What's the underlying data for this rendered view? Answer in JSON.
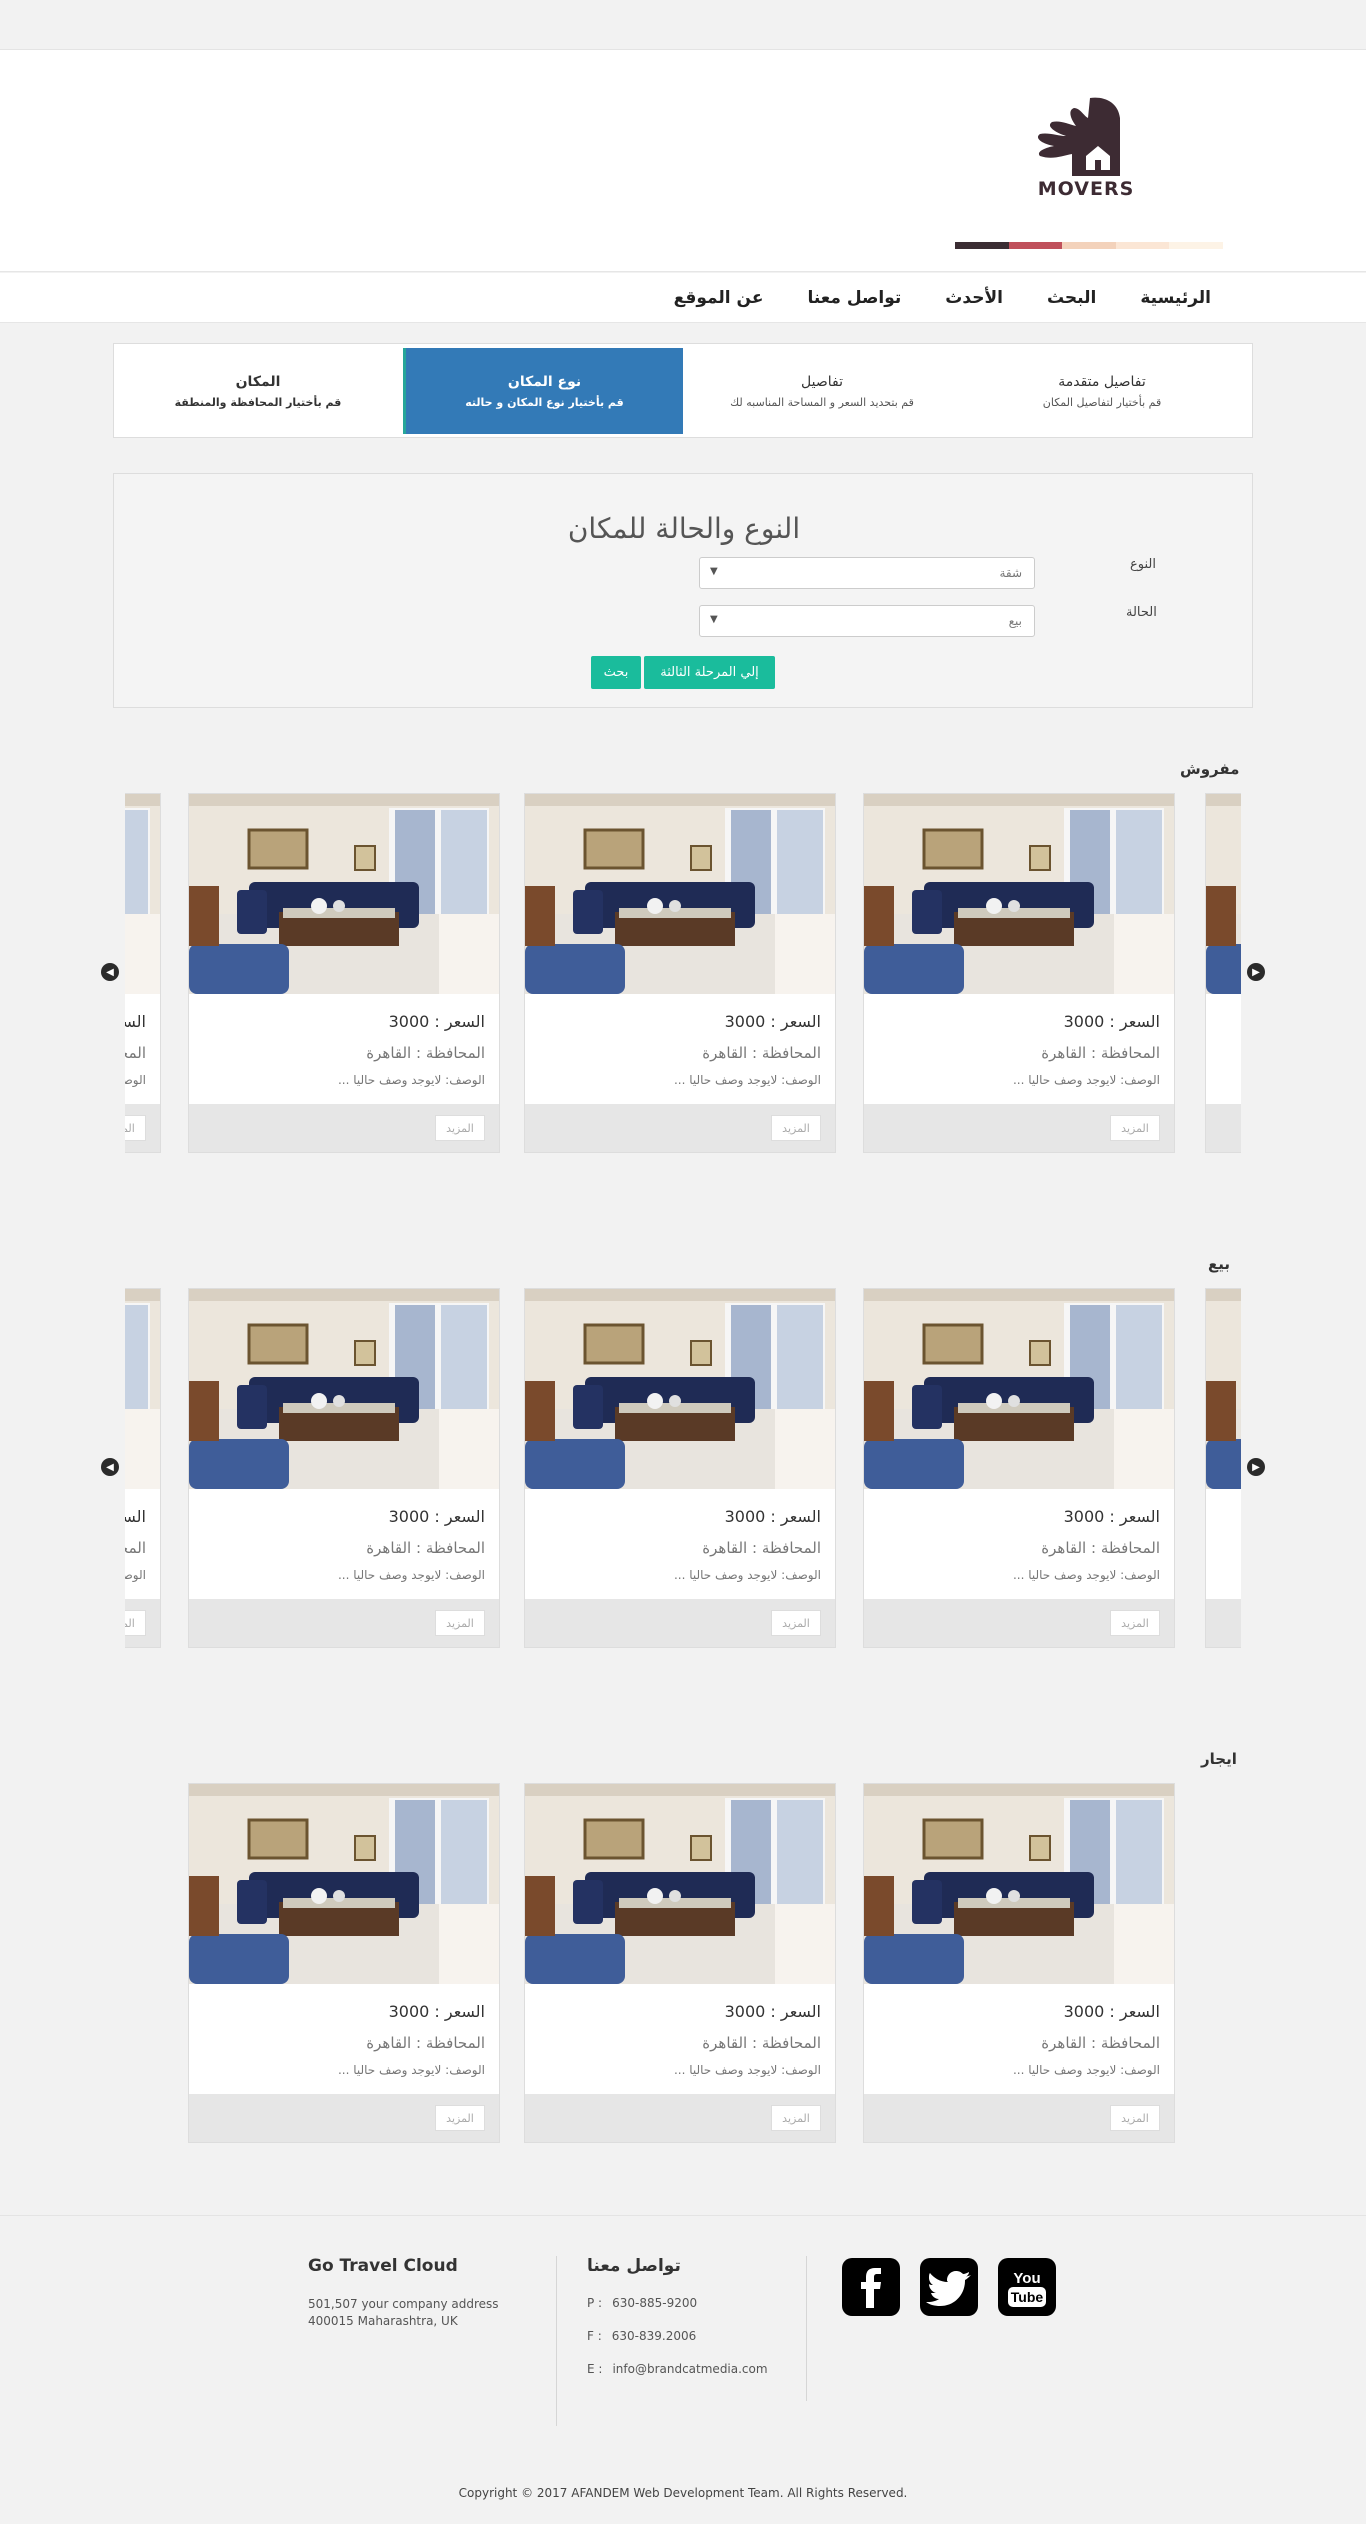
{
  "brand": {
    "name": "MOVERS",
    "colors": [
      "#3b2d33",
      "#c0505b",
      "#f3d2bb",
      "#fbe6d5",
      "#fdf3e6"
    ]
  },
  "nav": {
    "items": [
      "الرئيسية",
      "البحث",
      "الأحدث",
      "تواصل معنا",
      "عن الموقع"
    ]
  },
  "steps": [
    {
      "title": "تفاصيل متقدمة",
      "desc": "قم بأختيار لتفاصيل المكان"
    },
    {
      "title": "تفاصيل",
      "desc": "قم بتحديد السعر و المساحة المناسبه لك"
    },
    {
      "title": "نوع المكان",
      "desc": "قم بأختيار نوع المكان و حالته"
    },
    {
      "title": "المكان",
      "desc": "قم بأختيار المحافظة والمنطقة"
    }
  ],
  "form": {
    "title": "النوع والحالة للمكان",
    "type_label": "النوع",
    "type_value": "شقة",
    "status_label": "الحالة",
    "status_value": "بيع",
    "next_button": "إلي المرحلة الثالثة",
    "search_button": "بحث"
  },
  "sections": [
    {
      "title": "مفروش"
    },
    {
      "title": "بيع"
    },
    {
      "title": "ايجار"
    }
  ],
  "card": {
    "price": "السعر : 3000",
    "governorate": "المحافظة : القاهرة",
    "description": "الوصف: لايوجد وصف حاليا ...",
    "more": "المزيد"
  },
  "footer": {
    "company": "Go Travel Cloud",
    "address_line1": "501,507 your company address",
    "address_line2": "400015 Maharashtra, UK",
    "contact_title": "تواصل معنا",
    "phone_label": "P :",
    "phone": "630-885-9200",
    "fax_label": "F :",
    "fax": "630-839.2006",
    "email_label": "E :",
    "email": "info@brandcatmedia.com",
    "copyright": "Copyright © 2017 AFANDEM Web Development Team. All Rights Reserved."
  },
  "social": [
    "facebook-icon",
    "twitter-icon",
    "youtube-icon"
  ]
}
